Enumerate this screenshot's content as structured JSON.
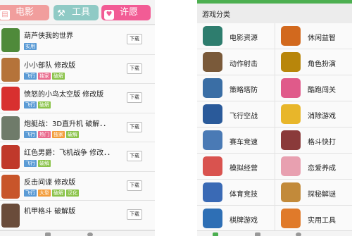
{
  "left": {
    "tabs": [
      {
        "label": "电影",
        "icon": "film-icon"
      },
      {
        "label": "工具",
        "icon": "tools-icon"
      },
      {
        "label": "许愿",
        "icon": "heart-icon"
      }
    ],
    "apps": [
      {
        "name": "葫芦侠我的世界",
        "tags": [
          {
            "text": "实用",
            "color": "#5b9bd5"
          }
        ],
        "download": "下载",
        "icon": "minecraft-game-icon",
        "icon_color": "#4f8a3a"
      },
      {
        "name": "小小部队  修改版",
        "tags": [
          {
            "text": "飞行",
            "color": "#5b9bd5"
          },
          {
            "text": "独家",
            "color": "#e96a8d"
          },
          {
            "text": "破解",
            "color": "#8bc34a"
          }
        ],
        "download": "下载",
        "icon": "soldier-game-icon",
        "icon_color": "#b5733a"
      },
      {
        "name": "愤怒的小鸟太空版  修改版",
        "tags": [
          {
            "text": "飞行",
            "color": "#5b9bd5"
          },
          {
            "text": "破解",
            "color": "#8bc34a"
          }
        ],
        "download": "下载",
        "icon": "angry-bird-game-icon",
        "icon_color": "#d8302f"
      },
      {
        "name": "炮艇战：3D直升机  破解．．",
        "tags": [
          {
            "text": "飞行",
            "color": "#5b9bd5"
          },
          {
            "text": "热门",
            "color": "#e96a8d"
          },
          {
            "text": "独家",
            "color": "#f39c3a"
          },
          {
            "text": "破解",
            "color": "#8bc34a"
          }
        ],
        "download": "下载",
        "icon": "helicopter-game-icon",
        "icon_color": "#6f7b6a"
      },
      {
        "name": "红色男爵：飞机战争  修改．．",
        "tags": [
          {
            "text": "飞行",
            "color": "#5b9bd5"
          },
          {
            "text": "破解",
            "color": "#8bc34a"
          }
        ],
        "download": "下载",
        "icon": "red-baron-game-icon",
        "icon_color": "#c0392b"
      },
      {
        "name": "反击间谍  修改版",
        "tags": [
          {
            "text": "飞行",
            "color": "#5b9bd5"
          },
          {
            "text": "大型",
            "color": "#f39c3a"
          },
          {
            "text": "破解",
            "color": "#8bc34a"
          },
          {
            "text": "汉化",
            "color": "#8bc34a"
          }
        ],
        "download": "下载",
        "icon": "spy-game-icon",
        "icon_color": "#c8552a"
      },
      {
        "name": "机甲格斗  破解版",
        "tags": [],
        "download": "下载",
        "icon": "mech-game-icon",
        "icon_color": "#6a4c3a"
      }
    ]
  },
  "right": {
    "title": "游戏分类",
    "categories": [
      {
        "label": "电影资源",
        "icon": "movie-resource-icon",
        "color": "#2e7d6e"
      },
      {
        "label": "休闲益智",
        "icon": "casual-puzzle-icon",
        "color": "#d2691e"
      },
      {
        "label": "动作射击",
        "icon": "action-shooting-icon",
        "color": "#7a5a3a"
      },
      {
        "label": "角色扮演",
        "icon": "role-playing-icon",
        "color": "#b8860b"
      },
      {
        "label": "策略塔防",
        "icon": "strategy-tower-icon",
        "color": "#3a6ea5"
      },
      {
        "label": "酷跑闯关",
        "icon": "parkour-icon",
        "color": "#e05a8a"
      },
      {
        "label": "飞行空战",
        "icon": "air-combat-icon",
        "color": "#2a5a9a"
      },
      {
        "label": "消除游戏",
        "icon": "match-game-icon",
        "color": "#e8b62a"
      },
      {
        "label": "赛车竞速",
        "icon": "racing-icon",
        "color": "#4a7ab5"
      },
      {
        "label": "格斗快打",
        "icon": "fighting-icon",
        "color": "#8a3a3a"
      },
      {
        "label": "模拟经营",
        "icon": "simulation-icon",
        "color": "#d9534f"
      },
      {
        "label": "恋爱养成",
        "icon": "romance-icon",
        "color": "#e8a0b0"
      },
      {
        "label": "体育竞技",
        "icon": "sports-icon",
        "color": "#3a6ab5"
      },
      {
        "label": "探秘解谜",
        "icon": "mystery-icon",
        "color": "#c28a3a"
      },
      {
        "label": "棋牌游戏",
        "icon": "board-card-icon",
        "color": "#2e6fb5"
      },
      {
        "label": "实用工具",
        "icon": "utility-icon",
        "color": "#e07a2a"
      }
    ]
  }
}
